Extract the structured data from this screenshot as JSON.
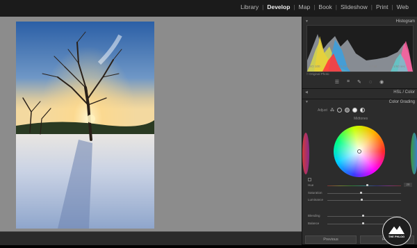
{
  "modules": [
    "Library",
    "Develop",
    "Map",
    "Book",
    "Slideshow",
    "Print",
    "Web"
  ],
  "active_module": "Develop",
  "histogram": {
    "title": "Histogram",
    "ticks": [
      "ISO 100",
      "24 mm",
      "f / 16",
      "1/60 sec"
    ],
    "original_photo_label": "Original Photo"
  },
  "panels": {
    "hsl": "HSL / Color",
    "color_grading": "Color Grading",
    "adjust_label": "Adjust",
    "wheel_title": "Midtones"
  },
  "sliders": [
    {
      "label": "Hue",
      "value": "28",
      "pos": 0.53
    },
    {
      "label": "Saturation",
      "value": "",
      "pos": 0.44
    },
    {
      "label": "Luminance",
      "value": "",
      "pos": 0.45
    },
    {
      "label": "Blending",
      "value": "",
      "pos": 0.47
    },
    {
      "label": "Balance",
      "value": "",
      "pos": 0.47
    }
  ],
  "buttons": {
    "previous": "Previous",
    "reset": "Reset"
  },
  "logo": {
    "text": "THE PHLOG"
  },
  "colors": {
    "accent_wheel": "rainbow",
    "bg_main": "#8c8c8c",
    "panel": "#2c2c2c"
  }
}
